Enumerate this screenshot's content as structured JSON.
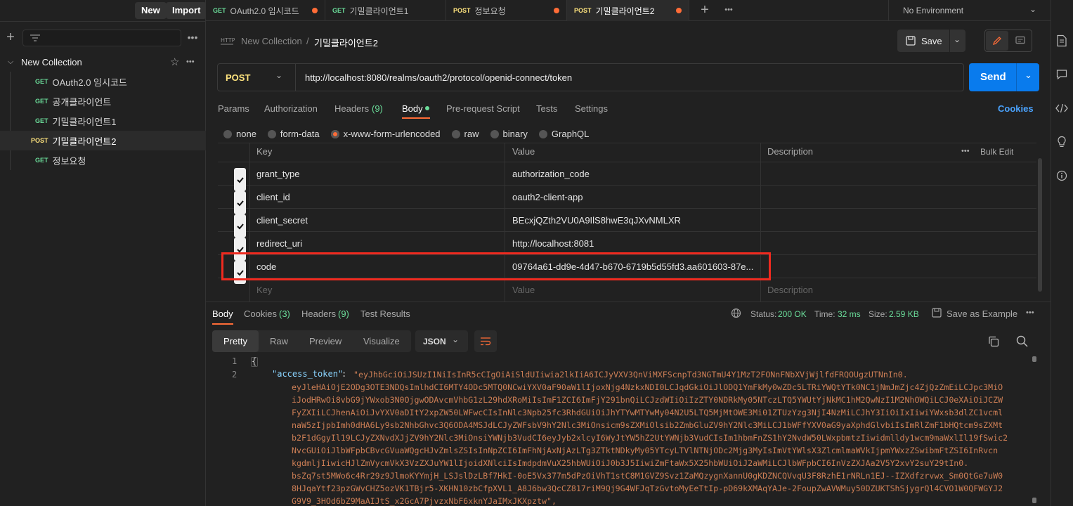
{
  "sidebar": {
    "new_label": "New",
    "import_label": "Import",
    "collection_name": "New Collection",
    "items": [
      {
        "method": "GET",
        "name": "OAuth2.0 임시코드"
      },
      {
        "method": "GET",
        "name": "공개클라이언트"
      },
      {
        "method": "GET",
        "name": "기밀클라이언트1"
      },
      {
        "method": "POST",
        "name": "기밀클라이언트2"
      },
      {
        "method": "GET",
        "name": "정보요청"
      }
    ]
  },
  "tabs": [
    {
      "method": "GET",
      "name": "OAuth2.0 임시코드"
    },
    {
      "method": "GET",
      "name": "기밀클라이언트1"
    },
    {
      "method": "POST",
      "name": "정보요청"
    },
    {
      "method": "POST",
      "name": "기밀클라이언트2"
    }
  ],
  "environment": "No Environment",
  "breadcrumb": {
    "collection": "New Collection",
    "separator": "/",
    "request": "기밀클라이언트2"
  },
  "save_label": "Save",
  "request": {
    "method": "POST",
    "url": "http://localhost:8080/realms/oauth2/protocol/openid-connect/token",
    "send_label": "Send"
  },
  "req_tabs": {
    "params": "Params",
    "authorization": "Authorization",
    "headers": "Headers",
    "headers_count": "(9)",
    "body": "Body",
    "prerequest": "Pre-request Script",
    "tests": "Tests",
    "settings": "Settings",
    "cookies": "Cookies"
  },
  "body_types": [
    "none",
    "form-data",
    "x-www-form-urlencoded",
    "raw",
    "binary",
    "GraphQL"
  ],
  "table": {
    "headers": {
      "key": "Key",
      "value": "Value",
      "description": "Description",
      "bulk_edit": "Bulk Edit"
    },
    "rows": [
      {
        "key": "grant_type",
        "value": "authorization_code"
      },
      {
        "key": "client_id",
        "value": "oauth2-client-app"
      },
      {
        "key": "client_secret",
        "value": "BEcxjQZth2VU0A9IlS8hwE3qJXvNMLXR"
      },
      {
        "key": "redirect_uri",
        "value": "http://localhost:8081"
      },
      {
        "key": "code",
        "value": "09764a61-dd9e-4d47-b670-6719b5d55fd3.aa601603-87e..."
      }
    ],
    "placeholder": {
      "key": "Key",
      "value": "Value",
      "description": "Description"
    }
  },
  "response": {
    "tabs": {
      "body": "Body",
      "cookies": "Cookies",
      "cookies_count": "(3)",
      "headers": "Headers",
      "headers_count": "(9)",
      "tests": "Test Results"
    },
    "status_label": "Status:",
    "status": "200 OK",
    "time_label": "Time:",
    "time": "32 ms",
    "size_label": "Size:",
    "size": "2.59 KB",
    "save_example": "Save as Example",
    "view_modes": [
      "Pretty",
      "Raw",
      "Preview",
      "Visualize"
    ],
    "format": "JSON",
    "line_numbers": [
      "1",
      "2"
    ],
    "json": {
      "open_brace": "{",
      "key": "\"access_token\"",
      "colon": ": ",
      "lines": [
        "\"eyJhbGciOiJSUzI1NiIsInR5cCIgOiAiSldUIiwia2lkIiA6ICJyVXV3QnViMXFScnpTd3NGTmU4Y1MzT2FONnFNbXVjWjlfdFRQOUgzUTNnIn0.",
        "eyJleHAiOjE2ODg3OTE3NDQsImlhdCI6MTY4ODc5MTQ0NCwiYXV0aF90aW1lIjoxNjg4NzkxNDI0LCJqdGkiOiJlODQ1YmFkMy0wZDc5LTRiYWQtYTk0NC1jNmJmZjc4ZjQzZmEiLCJpc3MiO",
        "iJodHRwOi8vbG9jYWxob3N0OjgwODAvcmVhbG1zL29hdXRoMiIsImF1ZCI6ImFjY291bnQiLCJzdWIiOiIzZTY0NDRkMy05NTczLTQ5YWUtYjNkMC1hM2QwNzI1M2NhOWQiLCJ0eXAiOiJCZW",
        "FyZXIiLCJhenAiOiJvYXV0aDItY2xpZW50LWFwcCIsInNlc3Npb25fc3RhdGUiOiJhYTYwMTYwMy04N2U5LTQ5MjMtOWE3Mi01ZTUzYzg3NjI4NzMiLCJhY3IiOiIxIiwiYWxsb3dlZC1vcml",
        "naW5zIjpbImh0dHA6Ly9sb2NhbGhvc3Q6ODA4MSJdLCJyZWFsbV9hY2Nlc3MiOnsicm9sZXMiOlsib2ZmbGluZV9hY2Nlc3MiLCJ1bWFfYXV0aG9yaXphdGlvbiIsImRlZmF1bHQtcm9sZXMt",
        "b2F1dGgyIl19LCJyZXNvdXJjZV9hY2Nlc3MiOnsiYWNjb3VudCI6eyJyb2xlcyI6WyJtYW5hZ2UtYWNjb3VudCIsIm1hbmFnZS1hY2NvdW50LWxpbmtzIiwidmlldy1wcm9maWxlIl19fSwic2",
        "NvcGUiOiJlbWFpbCBvcGVuaWQgcHJvZmlsZSIsInNpZCI6ImFhNjAxNjAzLTg3ZTktNDkyMy05YTcyLTVlNTNjODc2Mjg3MyIsImVtYWlsX3ZlcmlmaWVkIjpmYWxzZSwibmFtZSI6InRvcn",
        "kgdmljIiwicHJlZmVycmVkX3VzZXJuYW1lIjoidXNlciIsImdpdmVuX25hbWUiOiJ0b3J5IiwiZmFtaWx5X25hbWUiOiJ2aWMiLCJlbWFpbCI6InVzZXJAa2V5Y2xvY2suY29tIn0.",
        "bsZq7st5MWo6c4Rr29z9JlmoKYYmjH_LSJslDzLBf7HkI-0oE5Vx377m5dPzOiVhT1stC8M1GVZ9Svz1ZaMQzygnXannU0gKDZNCQVvqU3F8RzhE1rNRLn1EJ--IZXdfzrvwx_Sm0QtGe7uW0",
        "8HJqaYtf23pzGWvCHZ5ozVK1TBjr5-XKHN10zbCfpXVL1_A8J6bw3QcCZ817riM9Qj9G4WFJqTzGvtoMyEeTtIp-pD69kXMAqYAJe-2FoupZwAVWMuy50DZUKTShSjygrQl4CVO1W0QFWGYJ2",
        "G9V9_3HOd6bZ9MaAIJtS_x2GcA7PjvzxNbF6xknYJaIMxJKXpztw\","
      ]
    }
  },
  "colors": {
    "accent": "#ff6c37",
    "send": "#097bed",
    "status_ok": "#6bdd9a",
    "highlight_box": "#f02a1f"
  }
}
